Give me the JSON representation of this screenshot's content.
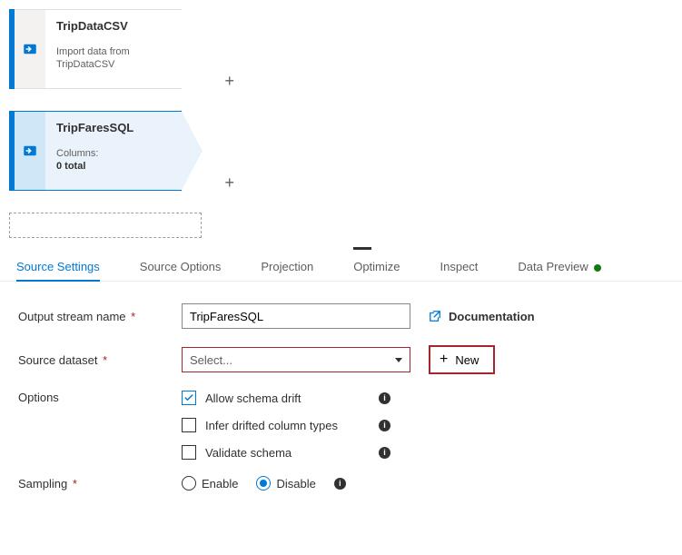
{
  "canvas": {
    "nodes": [
      {
        "title": "TripDataCSV",
        "subtitle": "Import data from TripDataCSV",
        "selected": false
      },
      {
        "title": "TripFaresSQL",
        "columns_label": "Columns:",
        "columns_value": "0 total",
        "selected": true
      }
    ]
  },
  "tabs": {
    "items": [
      {
        "label": "Source Settings",
        "active": true
      },
      {
        "label": "Source Options"
      },
      {
        "label": "Projection"
      },
      {
        "label": "Optimize",
        "marked": true
      },
      {
        "label": "Inspect"
      },
      {
        "label": "Data Preview",
        "dot": true
      }
    ]
  },
  "form": {
    "output_stream": {
      "label": "Output stream name",
      "value": "TripFaresSQL"
    },
    "documentation_label": "Documentation",
    "source_dataset": {
      "label": "Source dataset",
      "placeholder": "Select..."
    },
    "new_button": "New",
    "options": {
      "label": "Options",
      "items": [
        {
          "label": "Allow schema drift",
          "checked": true
        },
        {
          "label": "Infer drifted column types",
          "checked": false
        },
        {
          "label": "Validate schema",
          "checked": false
        }
      ]
    },
    "sampling": {
      "label": "Sampling",
      "enable": "Enable",
      "disable": "Disable",
      "selected": "disable"
    }
  }
}
